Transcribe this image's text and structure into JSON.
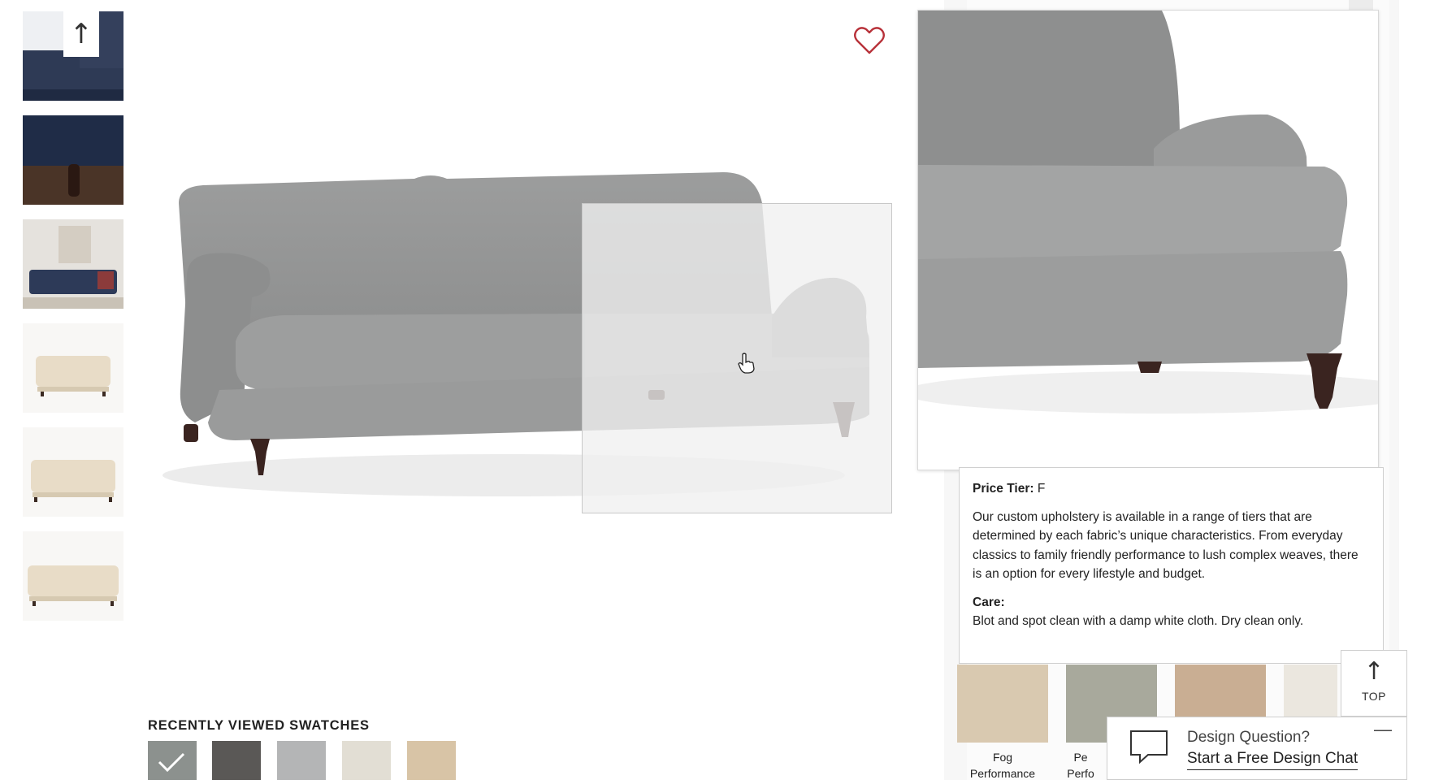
{
  "gallery": {
    "thumbnails": [
      {
        "name": "navy-sofa-closeup"
      },
      {
        "name": "navy-sofa-leg"
      },
      {
        "name": "navy-sofa-room"
      },
      {
        "name": "ivory-sofa-front"
      },
      {
        "name": "ivory-sofa-angle"
      },
      {
        "name": "ivory-sofa-side"
      }
    ],
    "scroll_up_icon": "↑"
  },
  "product": {
    "favorite_icon": "heart-icon"
  },
  "details": {
    "price_tier_label": "Price Tier:",
    "price_tier_value": "F",
    "description": "Our custom upholstery is available in a range of tiers that are determined by each fabric’s unique characteristics. From everyday classics to family friendly performance to lush complex weaves, there is an option for every lifestyle and budget.",
    "care_label": "Care:",
    "care_text": "Blot and spot clean with a damp white cloth. Dry clean only."
  },
  "swatch_row": [
    {
      "name": "Fog",
      "sub": "Performance",
      "color": "#d9c9b0"
    },
    {
      "name": "Pe",
      "sub": "Perfo",
      "color": "#a8a99c"
    },
    {
      "name": "",
      "sub": "",
      "color": "#c9ae93"
    },
    {
      "name": "",
      "sub": "",
      "color": "#ebe7df"
    }
  ],
  "top_button": {
    "label": "TOP"
  },
  "chat": {
    "question": "Design Question?",
    "cta": "Start a Free Design Chat",
    "minimize": "—"
  },
  "recently_viewed": {
    "title": "RECENTLY VIEWED SWATCHES",
    "swatches": [
      {
        "color": "#8c918e",
        "selected": true
      },
      {
        "color": "#5a5856",
        "selected": false
      },
      {
        "color": "#b4b5b6",
        "selected": false
      },
      {
        "color": "#e2ded4",
        "selected": false
      },
      {
        "color": "#d8c4a6",
        "selected": false
      }
    ]
  }
}
